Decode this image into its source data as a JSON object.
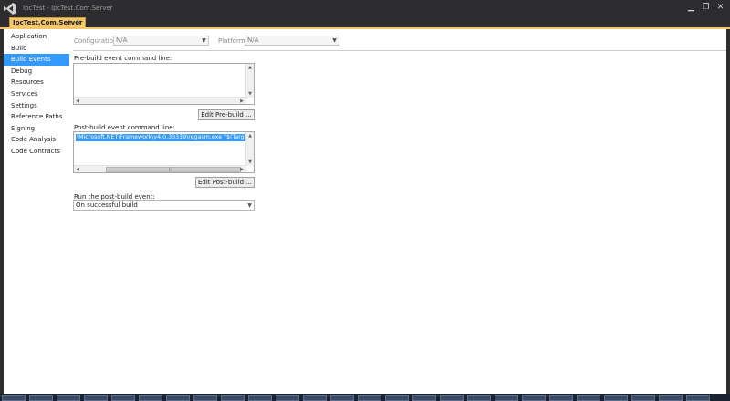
{
  "window": {
    "title": "IpcTest - IpcTest.Com.Server"
  },
  "document_tab": {
    "label": "IpcTest.Com.Server",
    "pin_glyph": "⊕",
    "close_glyph": "×",
    "color": "#f4c76a"
  },
  "nav": {
    "selected": "Build Events",
    "items": [
      {
        "label": "Application"
      },
      {
        "label": "Build"
      },
      {
        "label": "Build Events"
      },
      {
        "label": "Debug"
      },
      {
        "label": "Resources"
      },
      {
        "label": "Services"
      },
      {
        "label": "Settings"
      },
      {
        "label": "Reference Paths"
      },
      {
        "label": "Signing"
      },
      {
        "label": "Code Analysis"
      },
      {
        "label": "Code Contracts"
      }
    ]
  },
  "config": {
    "configuration_label": "Configuration:",
    "configuration_value": "N/A",
    "platform_label": "Platform:",
    "platform_value": "N/A"
  },
  "prebuild": {
    "label": "Pre-build event command line:",
    "value": "",
    "edit_button": "Edit Pre-build ..."
  },
  "postbuild": {
    "label": "Post-build event command line:",
    "value": "\\Microsoft.NET\\Framework\\v4.0.30319\\regasm.exe \"$(TargetPath)\"",
    "edit_button": "Edit Post-build ..."
  },
  "run_postbuild": {
    "label": "Run the post-build event:",
    "value": "On successful build"
  },
  "colors": {
    "selection": "#3399ff",
    "chrome": "#2d2d30"
  }
}
